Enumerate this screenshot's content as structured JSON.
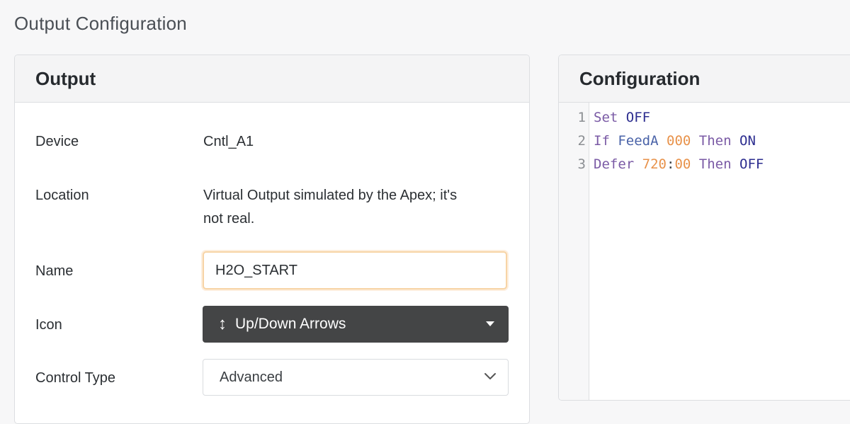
{
  "page": {
    "title": "Output Configuration"
  },
  "output_card": {
    "header": "Output",
    "device": {
      "label": "Device",
      "value": "Cntl_A1"
    },
    "location": {
      "label": "Location",
      "value_line1": "Virtual Output simulated by the Apex; it's",
      "value_line2": "not real."
    },
    "name": {
      "label": "Name",
      "value": "H2O_START"
    },
    "icon": {
      "label": "Icon",
      "selected": "Up/Down Arrows",
      "icon_glyph": "↕",
      "icon_name": "up-down-arrows-icon"
    },
    "control_type": {
      "label": "Control Type",
      "selected": "Advanced"
    }
  },
  "config_card": {
    "header": "Configuration",
    "lines": [
      {
        "no": "1",
        "tokens": [
          {
            "t": "Set",
            "c": "kw-purple"
          },
          {
            "t": " ",
            "c": "plain"
          },
          {
            "t": "OFF",
            "c": "kw-navy"
          }
        ]
      },
      {
        "no": "2",
        "tokens": [
          {
            "t": "If",
            "c": "kw-purple"
          },
          {
            "t": " ",
            "c": "plain"
          },
          {
            "t": "FeedA",
            "c": "kw-blue"
          },
          {
            "t": " ",
            "c": "plain"
          },
          {
            "t": "000",
            "c": "num-orange"
          },
          {
            "t": " ",
            "c": "plain"
          },
          {
            "t": "Then",
            "c": "kw-purple"
          },
          {
            "t": " ",
            "c": "plain"
          },
          {
            "t": "ON",
            "c": "kw-navy"
          }
        ]
      },
      {
        "no": "3",
        "tokens": [
          {
            "t": "Defer",
            "c": "kw-purple"
          },
          {
            "t": " ",
            "c": "plain"
          },
          {
            "t": "720",
            "c": "num-orange"
          },
          {
            "t": ":",
            "c": "plain"
          },
          {
            "t": "00",
            "c": "num-orange"
          },
          {
            "t": " ",
            "c": "plain"
          },
          {
            "t": "Then",
            "c": "kw-purple"
          },
          {
            "t": " ",
            "c": "plain"
          },
          {
            "t": "OFF",
            "c": "kw-navy"
          }
        ]
      }
    ]
  },
  "colors": {
    "focus_border": "#f7d4a6",
    "icon_select_bg": "#444546",
    "keyword": "#7a5aa5",
    "constant": "#2c2d8f",
    "number": "#e8924a"
  }
}
